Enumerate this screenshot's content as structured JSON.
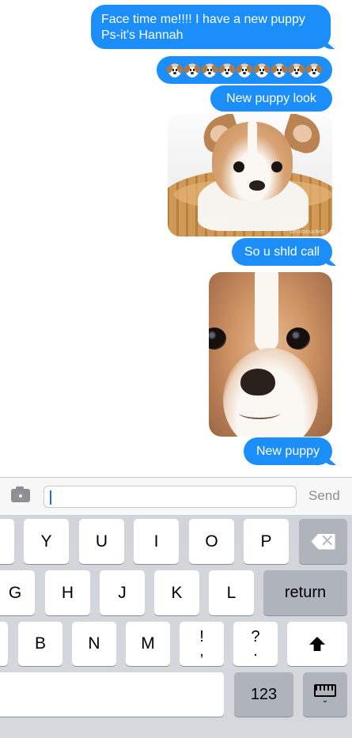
{
  "messages": {
    "msg1": {
      "line1": "Face time me!!!! I have a new puppy",
      "line2": "Ps-it's Hannah"
    },
    "msg2": {
      "emoji_count": 9,
      "emoji": "dog-face-emoji"
    },
    "msg3": {
      "text": "New puppy look"
    },
    "photo1": {
      "watermark": "photobucket"
    },
    "msg4": {
      "text": "So u shld call"
    },
    "msg5": {
      "text": "New puppy"
    }
  },
  "input_bar": {
    "send_label": "Send",
    "text_value": ""
  },
  "keyboard": {
    "row1": [
      "Y",
      "U",
      "I",
      "O",
      "P"
    ],
    "row2": [
      "G",
      "H",
      "J",
      "K",
      "L"
    ],
    "return_label": "return",
    "row3": [
      "B",
      "N",
      "M"
    ],
    "punct1": {
      "top": "!",
      "bottom": ","
    },
    "punct2": {
      "top": "?",
      "bottom": "."
    },
    "numbers_label": "123",
    "icons": [
      "delete-icon",
      "shift-icon",
      "keyboard-dismiss-icon",
      "camera-icon"
    ]
  },
  "colors": {
    "bubble": "#1c8ef9",
    "keyboard_bg": "#d1d4d9",
    "dark_key": "#aeb3bc"
  }
}
